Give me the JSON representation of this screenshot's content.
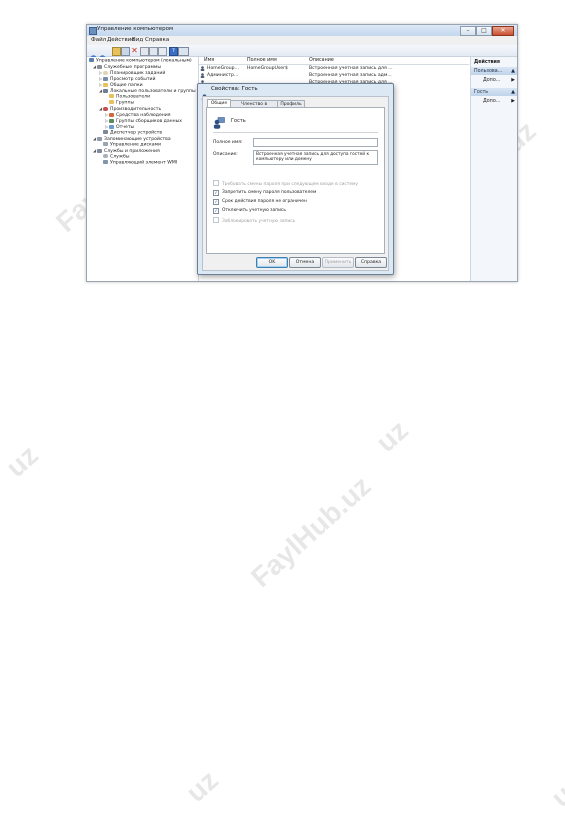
{
  "watermark": {
    "text": "FaylHub.uz",
    "partial_text": "uz"
  },
  "window": {
    "title": "Управление компьютером"
  },
  "menu": [
    "Файл",
    "Действие",
    "Вид",
    "Справка"
  ],
  "tree": [
    {
      "label": "Управление компьютером (локальным)",
      "level": 0,
      "icon": "computer-icon"
    },
    {
      "label": "Служебные программы",
      "level": 1,
      "icon": "tools-icon"
    },
    {
      "label": "Планировщик заданий",
      "level": 2,
      "icon": "clock-icon"
    },
    {
      "label": "Просмотр событий",
      "level": 2,
      "icon": "event-viewer-icon"
    },
    {
      "label": "Общие папки",
      "level": 2,
      "icon": "shared-folder-icon"
    },
    {
      "label": "Локальные пользователи и группы",
      "level": 2,
      "icon": "users-icon"
    },
    {
      "label": "Пользователи",
      "level": 3,
      "icon": "folder-icon"
    },
    {
      "label": "Группы",
      "level": 3,
      "icon": "folder-icon"
    },
    {
      "label": "Производительность",
      "level": 2,
      "icon": "performance-icon"
    },
    {
      "label": "Средства наблюдения",
      "level": 3,
      "icon": "monitor-icon"
    },
    {
      "label": "Группы сборщиков данных",
      "level": 3,
      "icon": "data-collector-icon"
    },
    {
      "label": "Отчеты",
      "level": 3,
      "icon": "reports-icon"
    },
    {
      "label": "Диспетчер устройств",
      "level": 2,
      "icon": "device-manager-icon"
    },
    {
      "label": "Запоминающие устройства",
      "level": 1,
      "icon": "storage-icon"
    },
    {
      "label": "Управление дисками",
      "level": 2,
      "icon": "disk-icon"
    },
    {
      "label": "Службы и приложения",
      "level": 1,
      "icon": "services-apps-icon"
    },
    {
      "label": "Службы",
      "level": 2,
      "icon": "services-icon"
    },
    {
      "label": "Управляющий элемент WMI",
      "level": 2,
      "icon": "wmi-icon"
    }
  ],
  "list": {
    "headers": [
      "Имя",
      "Полное имя",
      "Описание"
    ],
    "rows": [
      {
        "name": "HomeGroup...",
        "full_name": "HomeGroupUser$",
        "description": "Встроенная учетная запись для ..."
      },
      {
        "name": "Администр...",
        "full_name": "",
        "description": "Встроенная учетная запись адм..."
      },
      {
        "name": "",
        "full_name": "",
        "description": "Встроенная учетная запись для ..."
      }
    ]
  },
  "actions": {
    "header": "Действия",
    "sections": [
      {
        "title": "Пользова...",
        "more": "Допо..."
      },
      {
        "title": "Гость",
        "more": "Допо..."
      }
    ]
  },
  "dialog": {
    "title": "Свойства: Гость",
    "tabs": [
      "Общие",
      "Членство в группах",
      "Профиль"
    ],
    "user_name": "Гость",
    "full_name_label": "Полное имя:",
    "full_name_value": "",
    "description_label": "Описание:",
    "description_value": "Встроенная учетная запись для доступа гостей к компьютеру или домену",
    "checkboxes": [
      {
        "label": "Требовать смены пароля при следующем входе в систему",
        "checked": false,
        "enabled": false
      },
      {
        "label": "Запретить смену пароля пользователем",
        "checked": true,
        "enabled": true
      },
      {
        "label": "Срок действия пароля не ограничен",
        "checked": true,
        "enabled": true
      },
      {
        "label": "Отключить учетную запись",
        "checked": true,
        "enabled": true
      },
      {
        "label": "Заблокировать учетную запись",
        "checked": false,
        "enabled": false
      }
    ],
    "buttons": {
      "ok": "OK",
      "cancel": "Отмена",
      "apply": "Применить",
      "help": "Справка"
    }
  },
  "colors": {
    "accent": "#3c7fb1",
    "title_bar": "#c4d7ee",
    "dialog_frame": "#dde8f5"
  }
}
